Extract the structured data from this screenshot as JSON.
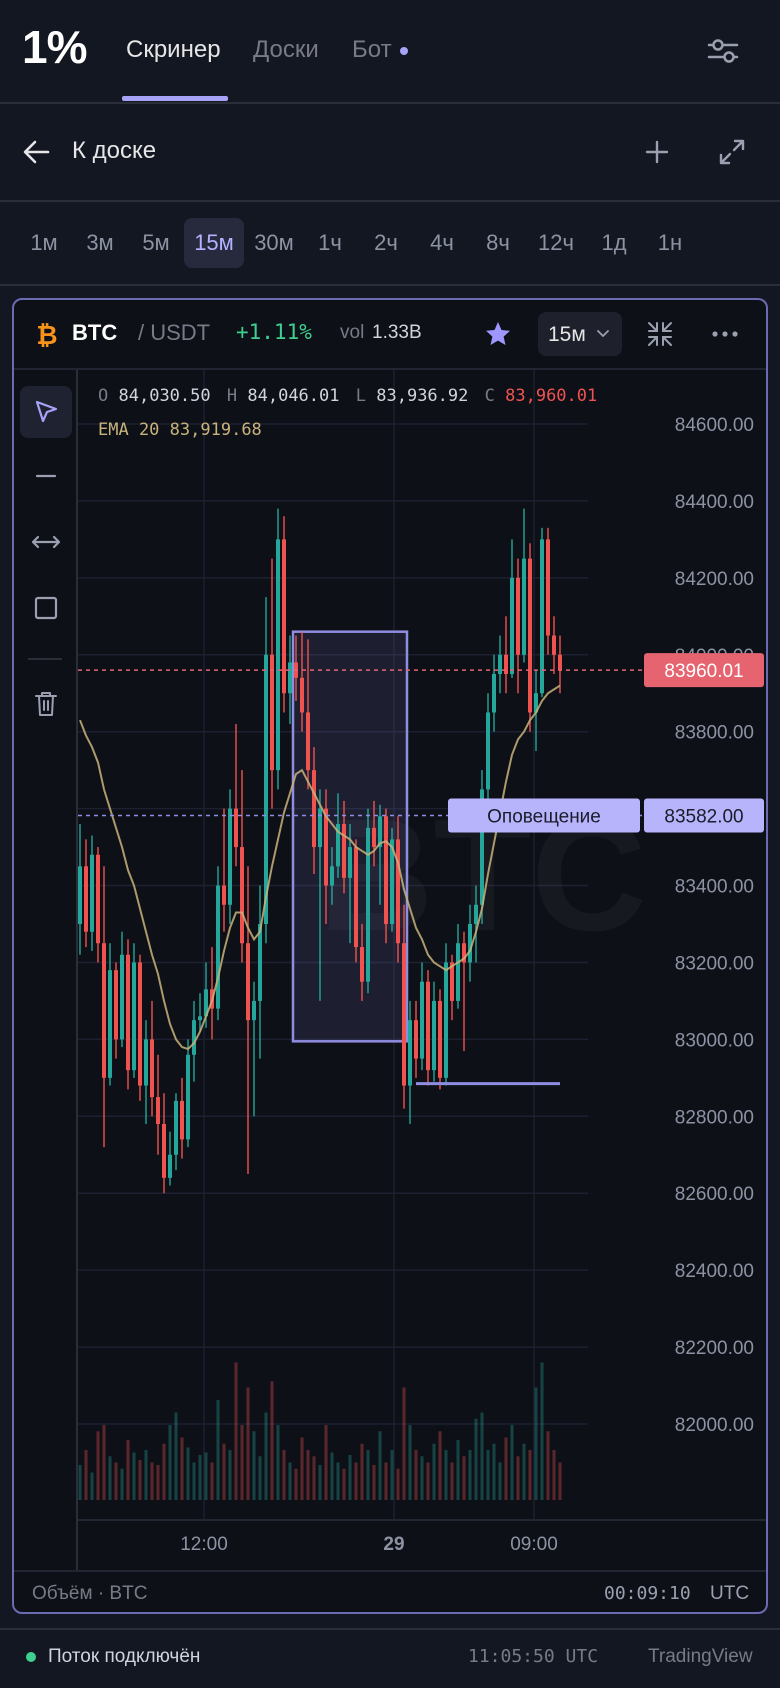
{
  "nav": {
    "logo": "1%",
    "tabs": [
      {
        "label": "Скринер",
        "active": true
      },
      {
        "label": "Доски",
        "active": false
      },
      {
        "label": "Бот",
        "active": false,
        "dot": true
      }
    ],
    "settings_icon": "sliders-icon"
  },
  "back": {
    "label": "К доске",
    "icons": [
      "arrow-left-icon",
      "plus-icon",
      "expand-icon"
    ]
  },
  "timeframes": {
    "items": [
      "1м",
      "3м",
      "5м",
      "15м",
      "30м",
      "1ч",
      "2ч",
      "4ч",
      "8ч",
      "12ч",
      "1д",
      "1н"
    ],
    "active": "15м"
  },
  "chart_header": {
    "symbol": "BTC",
    "quote": "/ USDT",
    "change": "+1.11%",
    "vol_label": "vol",
    "vol_value": "1.33B",
    "interval": "15м",
    "icons": [
      "bitcoin-icon",
      "star-icon",
      "chevron-down-icon",
      "collapse-icon",
      "more-icon"
    ]
  },
  "ohlc": {
    "o_label": "O",
    "o": "84,030.50",
    "h_label": "H",
    "h": "84,046.01",
    "l_label": "L",
    "l": "83,936.92",
    "c_label": "C",
    "c": "83,960.01",
    "ema_label": "EMA 20",
    "ema": "83,919.68"
  },
  "tools": [
    "cursor-icon",
    "horizontal-line-icon",
    "measure-icon",
    "rectangle-icon",
    "trash-icon"
  ],
  "watermark": "BTC",
  "colors": {
    "up": "#26a69a",
    "down": "#ef5350",
    "ema": "#c8b37a",
    "accent": "#a7a3f7",
    "price_tag": "#e5646f",
    "bg": "#131722"
  },
  "chart_data": {
    "type": "candlestick",
    "ylim": [
      82000,
      84600
    ],
    "y_ticks": [
      "84600.00",
      "84400.00",
      "84200.00",
      "84000.00",
      "83800.00",
      "83600.00",
      "83400.00",
      "83200.00",
      "83000.00",
      "82800.00",
      "82600.00",
      "82400.00",
      "82200.00",
      "82000.00"
    ],
    "x_ticks": [
      "12:00",
      "29",
      "09:00"
    ],
    "last_price": {
      "value": 83960.01,
      "label": "83960.01"
    },
    "alert": {
      "value": 83582.0,
      "label": "83582.00",
      "text": "Оповещение"
    },
    "rectangle": {
      "from_index": 36,
      "to_index": 54,
      "top": 84060,
      "bottom": 82995
    },
    "support_line": {
      "from_index": 56,
      "to_index": 80,
      "value": 82885
    },
    "volume_label": "Объём · BTC",
    "countdown": "00:09:10",
    "timezone": "UTC",
    "candles": [
      {
        "o": 83300,
        "h": 83560,
        "l": 83220,
        "c": 83450
      },
      {
        "o": 83450,
        "h": 83520,
        "l": 83240,
        "c": 83280
      },
      {
        "o": 83280,
        "h": 83530,
        "l": 83230,
        "c": 83480
      },
      {
        "o": 83480,
        "h": 83500,
        "l": 83200,
        "c": 83250
      },
      {
        "o": 83250,
        "h": 83450,
        "l": 82720,
        "c": 82900
      },
      {
        "o": 82900,
        "h": 83250,
        "l": 82880,
        "c": 83180
      },
      {
        "o": 83180,
        "h": 83200,
        "l": 82950,
        "c": 83000
      },
      {
        "o": 83000,
        "h": 83280,
        "l": 82980,
        "c": 83220
      },
      {
        "o": 83220,
        "h": 83260,
        "l": 82870,
        "c": 82920
      },
      {
        "o": 82920,
        "h": 83250,
        "l": 82900,
        "c": 83200
      },
      {
        "o": 83200,
        "h": 83220,
        "l": 82840,
        "c": 82880
      },
      {
        "o": 82880,
        "h": 83050,
        "l": 82780,
        "c": 83000
      },
      {
        "o": 83000,
        "h": 83100,
        "l": 82800,
        "c": 82850
      },
      {
        "o": 82850,
        "h": 82960,
        "l": 82700,
        "c": 82780
      },
      {
        "o": 82780,
        "h": 82860,
        "l": 82600,
        "c": 82640
      },
      {
        "o": 82640,
        "h": 82760,
        "l": 82620,
        "c": 82700
      },
      {
        "o": 82700,
        "h": 82860,
        "l": 82660,
        "c": 82840
      },
      {
        "o": 82840,
        "h": 82900,
        "l": 82690,
        "c": 82740
      },
      {
        "o": 82740,
        "h": 83000,
        "l": 82720,
        "c": 82960
      },
      {
        "o": 82960,
        "h": 83100,
        "l": 82890,
        "c": 83050
      },
      {
        "o": 83050,
        "h": 83120,
        "l": 83020,
        "c": 83060
      },
      {
        "o": 83060,
        "h": 83200,
        "l": 83030,
        "c": 83130
      },
      {
        "o": 83130,
        "h": 83240,
        "l": 83000,
        "c": 83080
      },
      {
        "o": 83080,
        "h": 83450,
        "l": 83050,
        "c": 83400
      },
      {
        "o": 83400,
        "h": 83600,
        "l": 83280,
        "c": 83350
      },
      {
        "o": 83350,
        "h": 83650,
        "l": 83300,
        "c": 83600
      },
      {
        "o": 83600,
        "h": 83820,
        "l": 83450,
        "c": 83500
      },
      {
        "o": 83500,
        "h": 83700,
        "l": 83200,
        "c": 83250
      },
      {
        "o": 83250,
        "h": 83450,
        "l": 82650,
        "c": 83050
      },
      {
        "o": 83050,
        "h": 83150,
        "l": 82800,
        "c": 83100
      },
      {
        "o": 83100,
        "h": 83400,
        "l": 82950,
        "c": 83300
      },
      {
        "o": 83300,
        "h": 84150,
        "l": 83250,
        "c": 84000
      },
      {
        "o": 84000,
        "h": 84250,
        "l": 83600,
        "c": 83700
      },
      {
        "o": 83700,
        "h": 84380,
        "l": 83650,
        "c": 84300
      },
      {
        "o": 84300,
        "h": 84360,
        "l": 83850,
        "c": 83900
      },
      {
        "o": 83900,
        "h": 84050,
        "l": 83820,
        "c": 83980
      },
      {
        "o": 83980,
        "h": 84050,
        "l": 83880,
        "c": 83940
      },
      {
        "o": 83940,
        "h": 84060,
        "l": 83800,
        "c": 83850
      },
      {
        "o": 83850,
        "h": 84040,
        "l": 83650,
        "c": 83700
      },
      {
        "o": 83700,
        "h": 83760,
        "l": 83430,
        "c": 83500
      },
      {
        "o": 83500,
        "h": 83650,
        "l": 83100,
        "c": 83600
      },
      {
        "o": 83600,
        "h": 83650,
        "l": 83300,
        "c": 83400
      },
      {
        "o": 83400,
        "h": 83500,
        "l": 83350,
        "c": 83450
      },
      {
        "o": 83450,
        "h": 83640,
        "l": 83420,
        "c": 83560
      },
      {
        "o": 83560,
        "h": 83620,
        "l": 83380,
        "c": 83420
      },
      {
        "o": 83420,
        "h": 83560,
        "l": 83250,
        "c": 83500
      },
      {
        "o": 83500,
        "h": 83520,
        "l": 83200,
        "c": 83240
      },
      {
        "o": 83240,
        "h": 83300,
        "l": 83100,
        "c": 83150
      },
      {
        "o": 83150,
        "h": 83600,
        "l": 83120,
        "c": 83550
      },
      {
        "o": 83550,
        "h": 83620,
        "l": 83450,
        "c": 83500
      },
      {
        "o": 83500,
        "h": 83610,
        "l": 83350,
        "c": 83580
      },
      {
        "o": 83580,
        "h": 83600,
        "l": 83250,
        "c": 83300
      },
      {
        "o": 83300,
        "h": 83550,
        "l": 83280,
        "c": 83520
      },
      {
        "o": 83520,
        "h": 83580,
        "l": 83200,
        "c": 83250
      },
      {
        "o": 83250,
        "h": 83350,
        "l": 82820,
        "c": 82880
      },
      {
        "o": 82880,
        "h": 83100,
        "l": 82780,
        "c": 83050
      },
      {
        "o": 83050,
        "h": 83100,
        "l": 82900,
        "c": 82950
      },
      {
        "o": 82950,
        "h": 83200,
        "l": 82920,
        "c": 83150
      },
      {
        "o": 83150,
        "h": 83180,
        "l": 82880,
        "c": 82920
      },
      {
        "o": 82920,
        "h": 83150,
        "l": 82890,
        "c": 83100
      },
      {
        "o": 83100,
        "h": 83130,
        "l": 82870,
        "c": 82900
      },
      {
        "o": 82900,
        "h": 83250,
        "l": 82880,
        "c": 83200
      },
      {
        "o": 83200,
        "h": 83220,
        "l": 83050,
        "c": 83100
      },
      {
        "o": 83100,
        "h": 83300,
        "l": 83080,
        "c": 83250
      },
      {
        "o": 83250,
        "h": 83280,
        "l": 82970,
        "c": 83200
      },
      {
        "o": 83200,
        "h": 83350,
        "l": 83150,
        "c": 83300
      },
      {
        "o": 83300,
        "h": 83400,
        "l": 83200,
        "c": 83350
      },
      {
        "o": 83350,
        "h": 83700,
        "l": 83300,
        "c": 83650
      },
      {
        "o": 83650,
        "h": 83900,
        "l": 83600,
        "c": 83850
      },
      {
        "o": 83850,
        "h": 84000,
        "l": 83800,
        "c": 83950
      },
      {
        "o": 83950,
        "h": 84050,
        "l": 83900,
        "c": 84000
      },
      {
        "o": 84000,
        "h": 84100,
        "l": 83900,
        "c": 83950
      },
      {
        "o": 83950,
        "h": 84300,
        "l": 83940,
        "c": 84200
      },
      {
        "o": 84200,
        "h": 84250,
        "l": 83900,
        "c": 84000
      },
      {
        "o": 84000,
        "h": 84380,
        "l": 83980,
        "c": 84250
      },
      {
        "o": 84250,
        "h": 84290,
        "l": 83800,
        "c": 83850
      },
      {
        "o": 83850,
        "h": 83960,
        "l": 83750,
        "c": 83900
      },
      {
        "o": 83900,
        "h": 84330,
        "l": 83890,
        "c": 84300
      },
      {
        "o": 84300,
        "h": 84330,
        "l": 84000,
        "c": 84050
      },
      {
        "o": 84050,
        "h": 84100,
        "l": 83950,
        "c": 84000
      },
      {
        "o": 84000,
        "h": 84050,
        "l": 83900,
        "c": 83960
      }
    ],
    "ema": [
      83830,
      83790,
      83760,
      83720,
      83650,
      83600,
      83550,
      83500,
      83440,
      83400,
      83340,
      83280,
      83220,
      83170,
      83100,
      83040,
      83000,
      82980,
      82975,
      82990,
      83020,
      83060,
      83100,
      83160,
      83230,
      83290,
      83330,
      83330,
      83290,
      83260,
      83280,
      83370,
      83450,
      83520,
      83590,
      83640,
      83690,
      83700,
      83670,
      83640,
      83610,
      83580,
      83560,
      83540,
      83530,
      83520,
      83500,
      83490,
      83480,
      83490,
      83510,
      83515,
      83500,
      83460,
      83390,
      83340,
      83290,
      83260,
      83220,
      83200,
      83190,
      83180,
      83190,
      83200,
      83210,
      83230,
      83280,
      83340,
      83430,
      83510,
      83590,
      83670,
      83740,
      83780,
      83800,
      83830,
      83850,
      83880,
      83900,
      83910,
      83920
    ],
    "volumes": [
      28,
      40,
      22,
      55,
      60,
      35,
      30,
      25,
      48,
      38,
      32,
      40,
      30,
      28,
      45,
      60,
      70,
      50,
      42,
      30,
      36,
      38,
      30,
      80,
      45,
      40,
      110,
      60,
      90,
      55,
      35,
      70,
      95,
      60,
      40,
      30,
      25,
      50,
      40,
      35,
      28,
      60,
      38,
      30,
      25,
      36,
      30,
      45,
      40,
      28,
      55,
      30,
      40,
      25,
      90,
      60,
      40,
      35,
      30,
      45,
      55,
      40,
      30,
      48,
      35,
      40,
      65,
      70,
      40,
      45,
      30,
      50,
      60,
      35,
      45,
      40,
      90,
      110,
      55,
      40,
      30
    ]
  },
  "status_bar": {
    "status": "Поток подключён",
    "time": "11:05:50 UTC",
    "source": "TradingView"
  }
}
